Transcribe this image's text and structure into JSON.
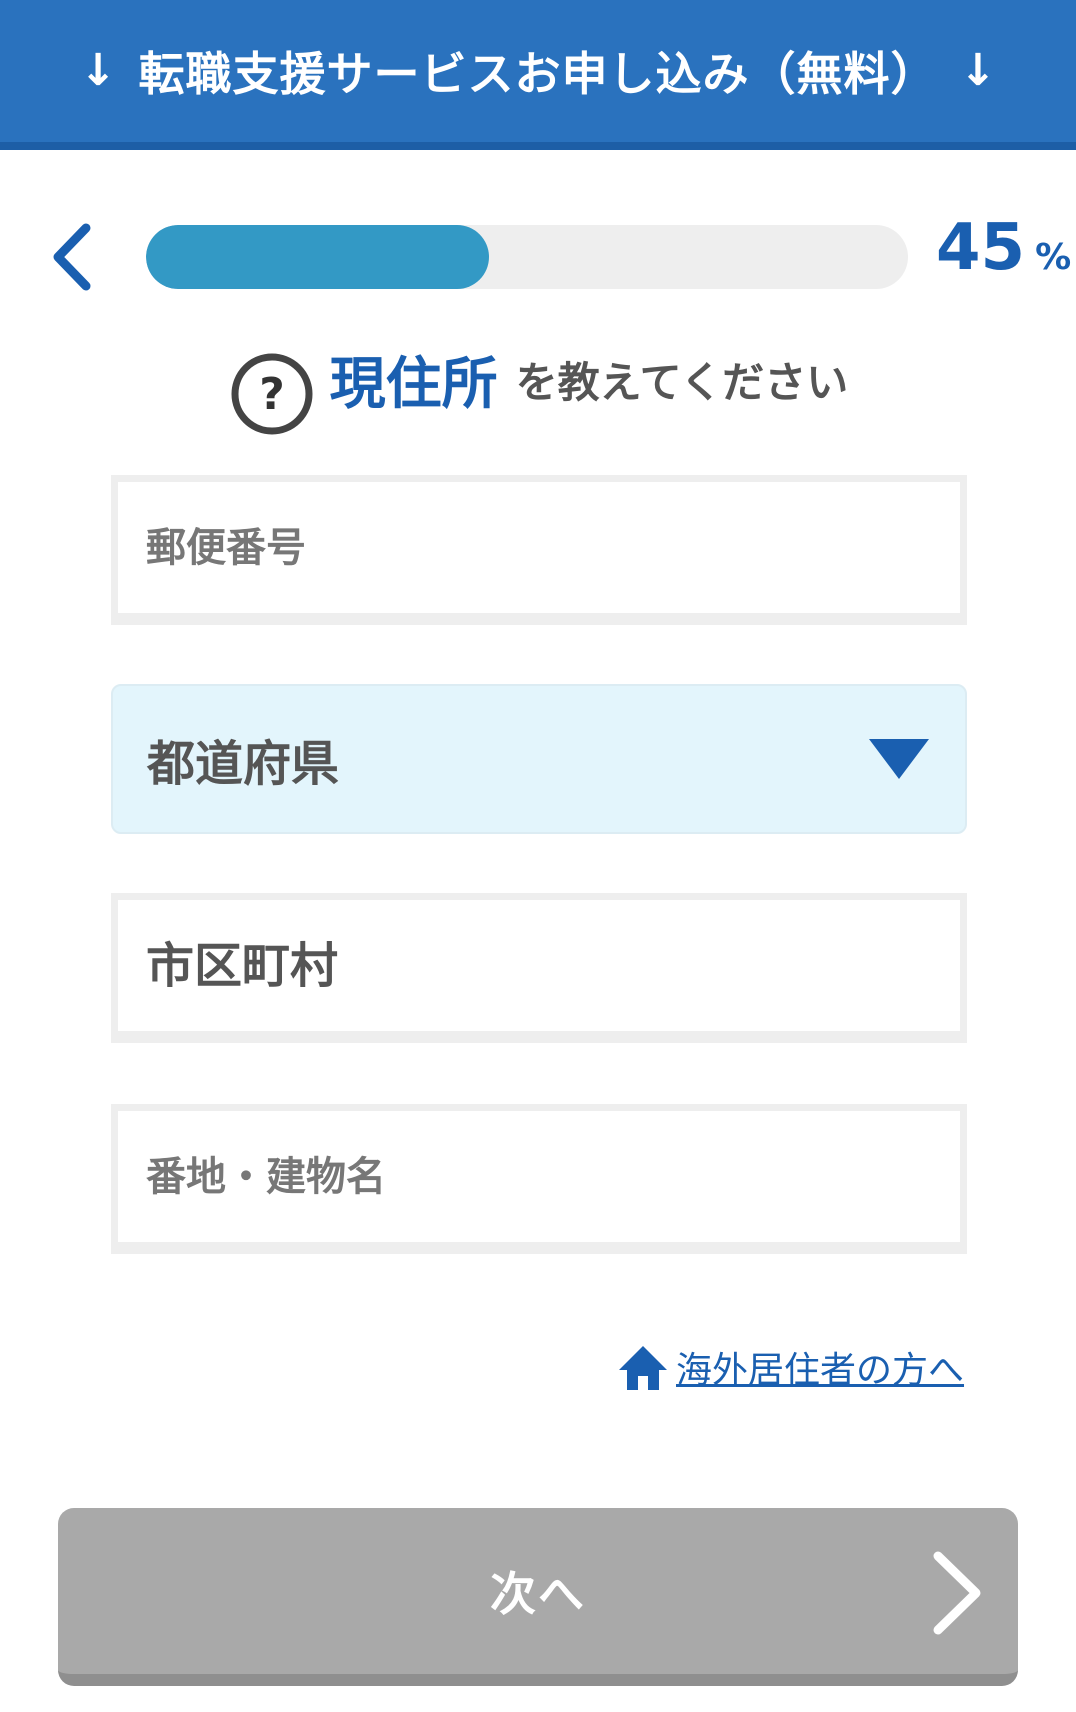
{
  "header": {
    "arrow_left": "↓",
    "title": "転職支援サービスお申し込み（無料）",
    "arrow_right": "↓"
  },
  "progress": {
    "value": 45,
    "value_text": "45",
    "unit": "%"
  },
  "question": {
    "emphasis": "現住所",
    "rest": "を教えてください"
  },
  "form": {
    "postal_code": {
      "placeholder": "郵便番号",
      "value": ""
    },
    "prefecture": {
      "label": "都道府県"
    },
    "city": {
      "placeholder": "市区町村",
      "value": ""
    },
    "address": {
      "placeholder": "番地・建物名",
      "value": ""
    }
  },
  "overseas_link": {
    "label": "海外居住者の方へ"
  },
  "next_button": {
    "label": "次へ"
  },
  "icons": {
    "back": "chevron-left-icon",
    "help": "question-circle-icon",
    "select": "caret-down-icon",
    "overseas": "home-icon",
    "next": "chevron-right-icon"
  },
  "colors": {
    "header_bg": "#2a72be",
    "accent": "#1a5fb0",
    "progress_fill": "#3399c5",
    "select_bg": "#e3f5fc",
    "button_disabled": "#a9a9a9"
  }
}
